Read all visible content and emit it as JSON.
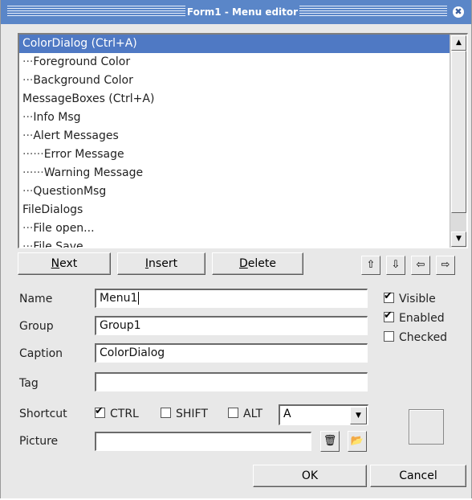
{
  "window": {
    "title": "Form1 - Menu editor",
    "close_glyph": "✖"
  },
  "tree": {
    "items": [
      {
        "dots": "",
        "label": "ColorDialog (Ctrl+A)",
        "selected": true
      },
      {
        "dots": "···",
        "label": "Foreground Color"
      },
      {
        "dots": "···",
        "label": "Background Color"
      },
      {
        "dots": "",
        "label": "MessageBoxes (Ctrl+A)"
      },
      {
        "dots": "···",
        "label": "Info Msg"
      },
      {
        "dots": "···",
        "label": "Alert Messages"
      },
      {
        "dots": "······",
        "label": "Error Message"
      },
      {
        "dots": "······",
        "label": "Warning Message"
      },
      {
        "dots": "···",
        "label": "QuestionMsg"
      },
      {
        "dots": "",
        "label": "FileDialogs"
      },
      {
        "dots": "···",
        "label": "File open..."
      },
      {
        "dots": "···",
        "label": "File Save..."
      }
    ],
    "scroll_up": "▲",
    "scroll_down": "▼"
  },
  "buttons": {
    "next_u": "N",
    "next_rest": "ext",
    "insert_u": "I",
    "insert_rest": "nsert",
    "delete_u": "D",
    "delete_rest": "elete",
    "up_glyph": "⇧",
    "down_glyph": "⇩",
    "left_glyph": "⇦",
    "right_glyph": "⇨",
    "ok": "OK",
    "cancel": "Cancel"
  },
  "form": {
    "name_label": "Name",
    "name_value": "Menu1",
    "group_label": "Group",
    "group_value": "Group1",
    "caption_label": "Caption",
    "caption_value": "ColorDialog",
    "tag_label": "Tag",
    "tag_value": "",
    "shortcut_label": "Shortcut",
    "picture_label": "Picture",
    "picture_value": ""
  },
  "checks": {
    "visible": "Visible",
    "visible_checked": true,
    "enabled": "Enabled",
    "enabled_checked": true,
    "checked": "Checked",
    "checked_checked": false,
    "ctrl": "CTRL",
    "ctrl_checked": true,
    "shift": "SHIFT",
    "shift_checked": false,
    "alt": "ALT",
    "alt_checked": false,
    "tick": "✔"
  },
  "shortcut_key": {
    "selected": "A",
    "dropdown_glyph": "▼"
  },
  "icons": {
    "trash": "🗑",
    "folder": "📂"
  }
}
